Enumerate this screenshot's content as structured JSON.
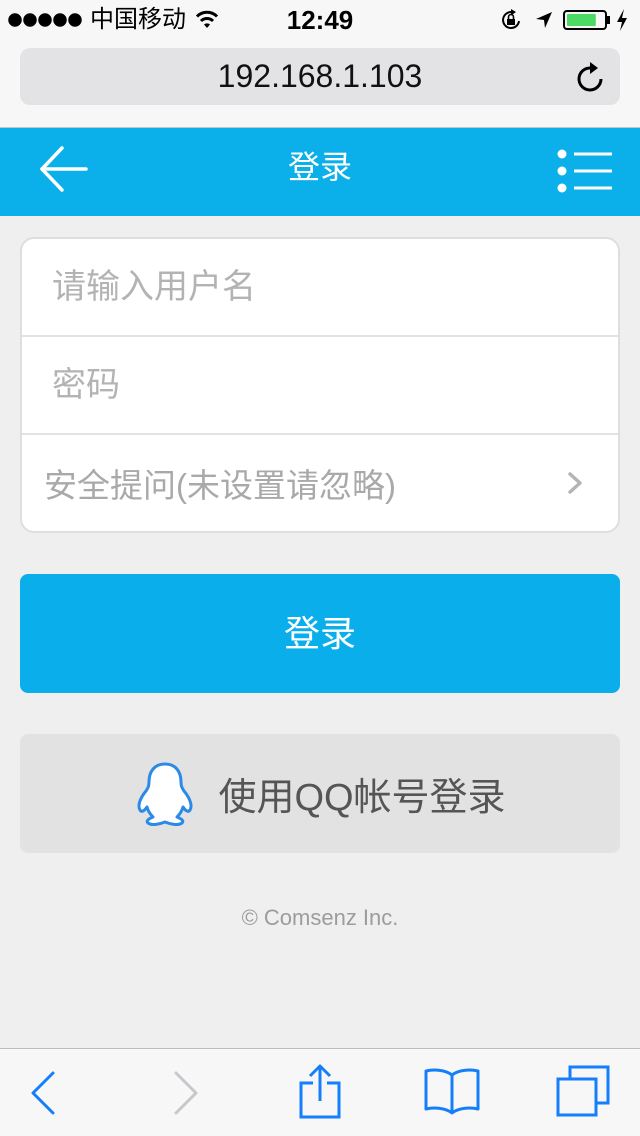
{
  "status_bar": {
    "carrier": "中国移动",
    "time": "12:49",
    "signal_bars": 5,
    "battery_level": 0.8,
    "icons": {
      "signal": "signal-dots-icon",
      "wifi": "wifi-icon",
      "rotation_lock": "rotation-lock-icon",
      "location": "location-arrow-icon",
      "battery": "battery-icon",
      "charging": "charging-bolt-icon"
    }
  },
  "browser": {
    "url": "192.168.1.103",
    "reload_icon": "reload-icon"
  },
  "header": {
    "title": "登录",
    "back_icon": "back-arrow-icon",
    "menu_icon": "menu-list-icon"
  },
  "login_form": {
    "username": {
      "placeholder": "请输入用户名"
    },
    "password": {
      "placeholder": "密码"
    },
    "security_question": {
      "selected": "安全提问(未设置请忽略)",
      "icon": "chevron-right-icon"
    }
  },
  "login_button": {
    "label": "登录"
  },
  "qq_login_button": {
    "label": "使用QQ帐号登录",
    "icon": "qq-penguin-icon"
  },
  "footer": {
    "copyright": "© Comsenz Inc."
  },
  "toolbar": {
    "buttons": [
      {
        "name": "back",
        "icon": "chevron-left-icon",
        "enabled": true
      },
      {
        "name": "forward",
        "icon": "chevron-right-icon",
        "enabled": false
      },
      {
        "name": "share",
        "icon": "share-icon",
        "enabled": true
      },
      {
        "name": "bookmarks",
        "icon": "book-icon",
        "enabled": true
      },
      {
        "name": "tabs",
        "icon": "tabs-icon",
        "enabled": true
      }
    ]
  },
  "colors": {
    "header": "#0bb0ea",
    "primary_button": "#0aaeeb",
    "qq_button": "#e2e2e2",
    "toolbar_icon": "#157efb",
    "toolbar_icon_disabled": "#c7c7cc",
    "battery": "#4cd964",
    "qq_icon": "#2b8ae6",
    "page_background": "#efefef"
  }
}
